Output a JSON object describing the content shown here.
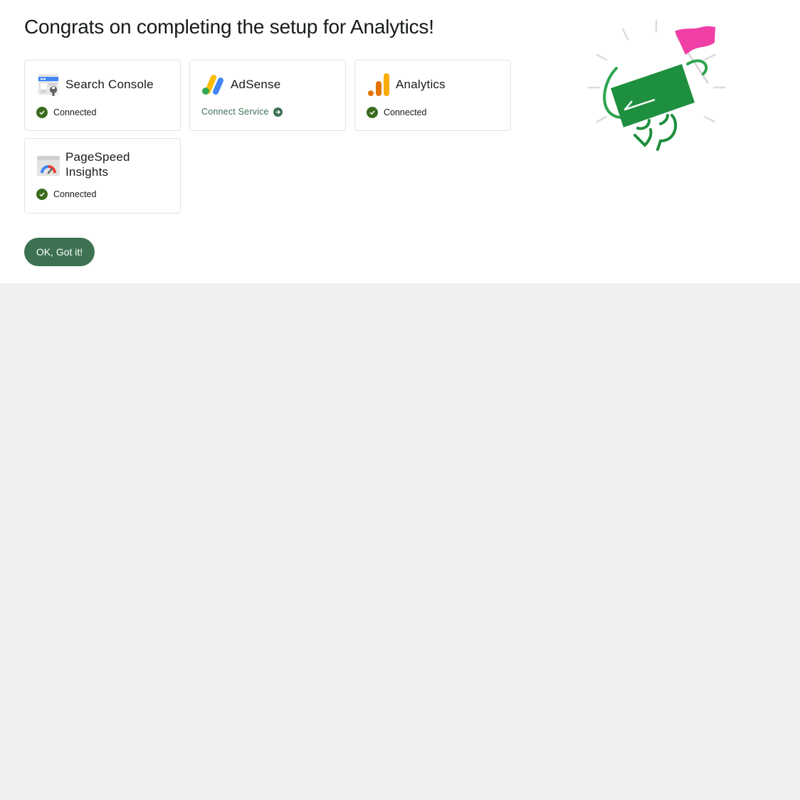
{
  "header": {
    "title": "Congrats on completing the setup for Analytics!"
  },
  "services": [
    {
      "name": "Search Console",
      "status": "Connected",
      "icon": "search-console-icon"
    },
    {
      "name": "AdSense",
      "action": "Connect Service",
      "icon": "adsense-icon"
    },
    {
      "name": "Analytics",
      "status": "Connected",
      "icon": "analytics-icon"
    },
    {
      "name_line1": "PageSpeed",
      "name_line2": "Insights",
      "status": "Connected",
      "icon": "pagespeed-insights-icon"
    }
  ],
  "footer": {
    "ok_label": "OK, Got it!"
  },
  "colors": {
    "brand_green": "#3c7251",
    "check_green": "#3a6b1e",
    "page_background": "#f0f0f0",
    "illustration_green": "#1e8f3e",
    "flag_pink": "#f03fa6"
  }
}
